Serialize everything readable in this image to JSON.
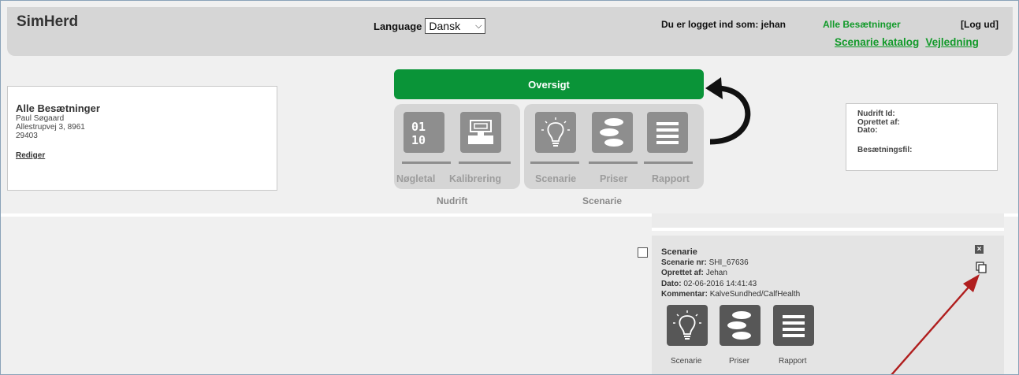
{
  "header": {
    "logo": "SimHerd",
    "language_label": "Language",
    "language_value": "Dansk",
    "logged_in": "Du er logget ind som: jehan",
    "herds_link": "Alle Besætninger",
    "logout": "[Log ud]",
    "catalog_link": "Scenarie katalog",
    "guide_link": "Vejledning"
  },
  "info_box": {
    "title": "Alle Besætninger",
    "owner": "Paul Søgaard",
    "address": "Allestrupvej 3, 8961",
    "number": "29403",
    "edit": "Rediger"
  },
  "nav": {
    "overview": "Oversigt",
    "nudrift_tiles": [
      {
        "label": "Nøgletal",
        "icon": "binary-icon"
      },
      {
        "label": "Kalibrering",
        "icon": "calibration-icon"
      }
    ],
    "scenarie_tiles": [
      {
        "label": "Scenarie",
        "icon": "lightbulb-icon"
      },
      {
        "label": "Priser",
        "icon": "coins-icon"
      },
      {
        "label": "Rapport",
        "icon": "report-icon"
      }
    ],
    "group_nudrift": "Nudrift",
    "group_scenarie": "Scenarie"
  },
  "right_box": {
    "nudrift_id": "Nudrift Id:",
    "created_by": "Oprettet af:",
    "date": "Dato:",
    "herd_file": "Besætningsfil:"
  },
  "scenario_card": {
    "title": "Scenarie",
    "nr_label": "Scenarie nr:",
    "nr_value": "SHI_67636",
    "created_label": "Oprettet af:",
    "created_value": "Jehan",
    "date_label": "Dato:",
    "date_value": "02-06-2016 14:41:43",
    "comment_label": "Kommentar:",
    "comment_value": "KalveSundhed/CalfHealth",
    "tiles": [
      {
        "label": "Scenarie",
        "icon": "lightbulb-icon"
      },
      {
        "label": "Priser",
        "icon": "coins-icon"
      },
      {
        "label": "Rapport",
        "icon": "report-icon"
      }
    ]
  },
  "colors": {
    "accent_green": "#0a9438",
    "link_green": "#129a2a",
    "annotation_arrow": "#b01e1e"
  }
}
